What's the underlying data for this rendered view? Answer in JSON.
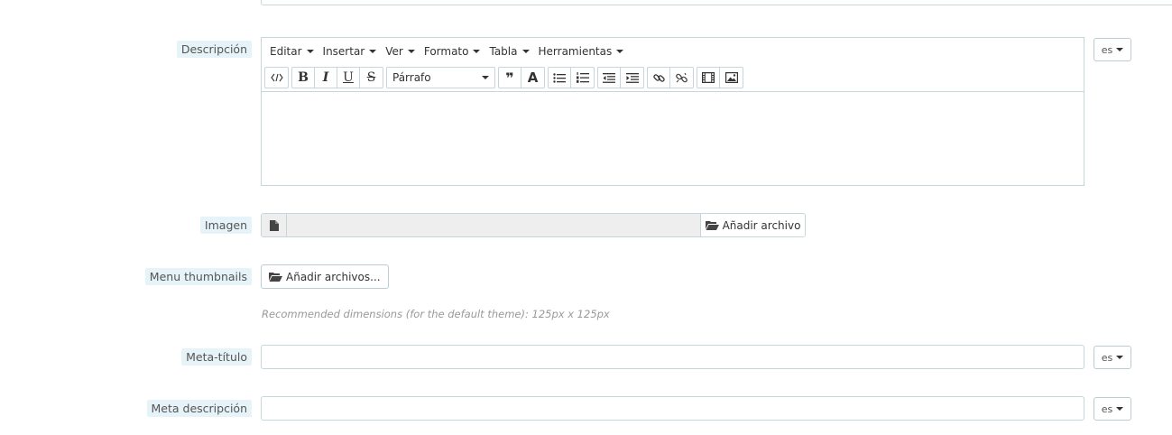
{
  "description": {
    "label": "Descripción",
    "menu": [
      "Editar",
      "Insertar",
      "Ver",
      "Formato",
      "Tabla",
      "Herramientas"
    ],
    "format_select": "Párrafo",
    "lang": "es"
  },
  "image": {
    "label": "Imagen",
    "button": "Añadir archivo"
  },
  "thumbnails": {
    "label": "Menu thumbnails",
    "button": "Añadir archivos...",
    "help": "Recommended dimensions (for the default theme): 125px x 125px"
  },
  "meta_title": {
    "label": "Meta-título",
    "value": "",
    "lang": "es"
  },
  "meta_description": {
    "label": "Meta descripción",
    "value": "",
    "lang": "es"
  }
}
